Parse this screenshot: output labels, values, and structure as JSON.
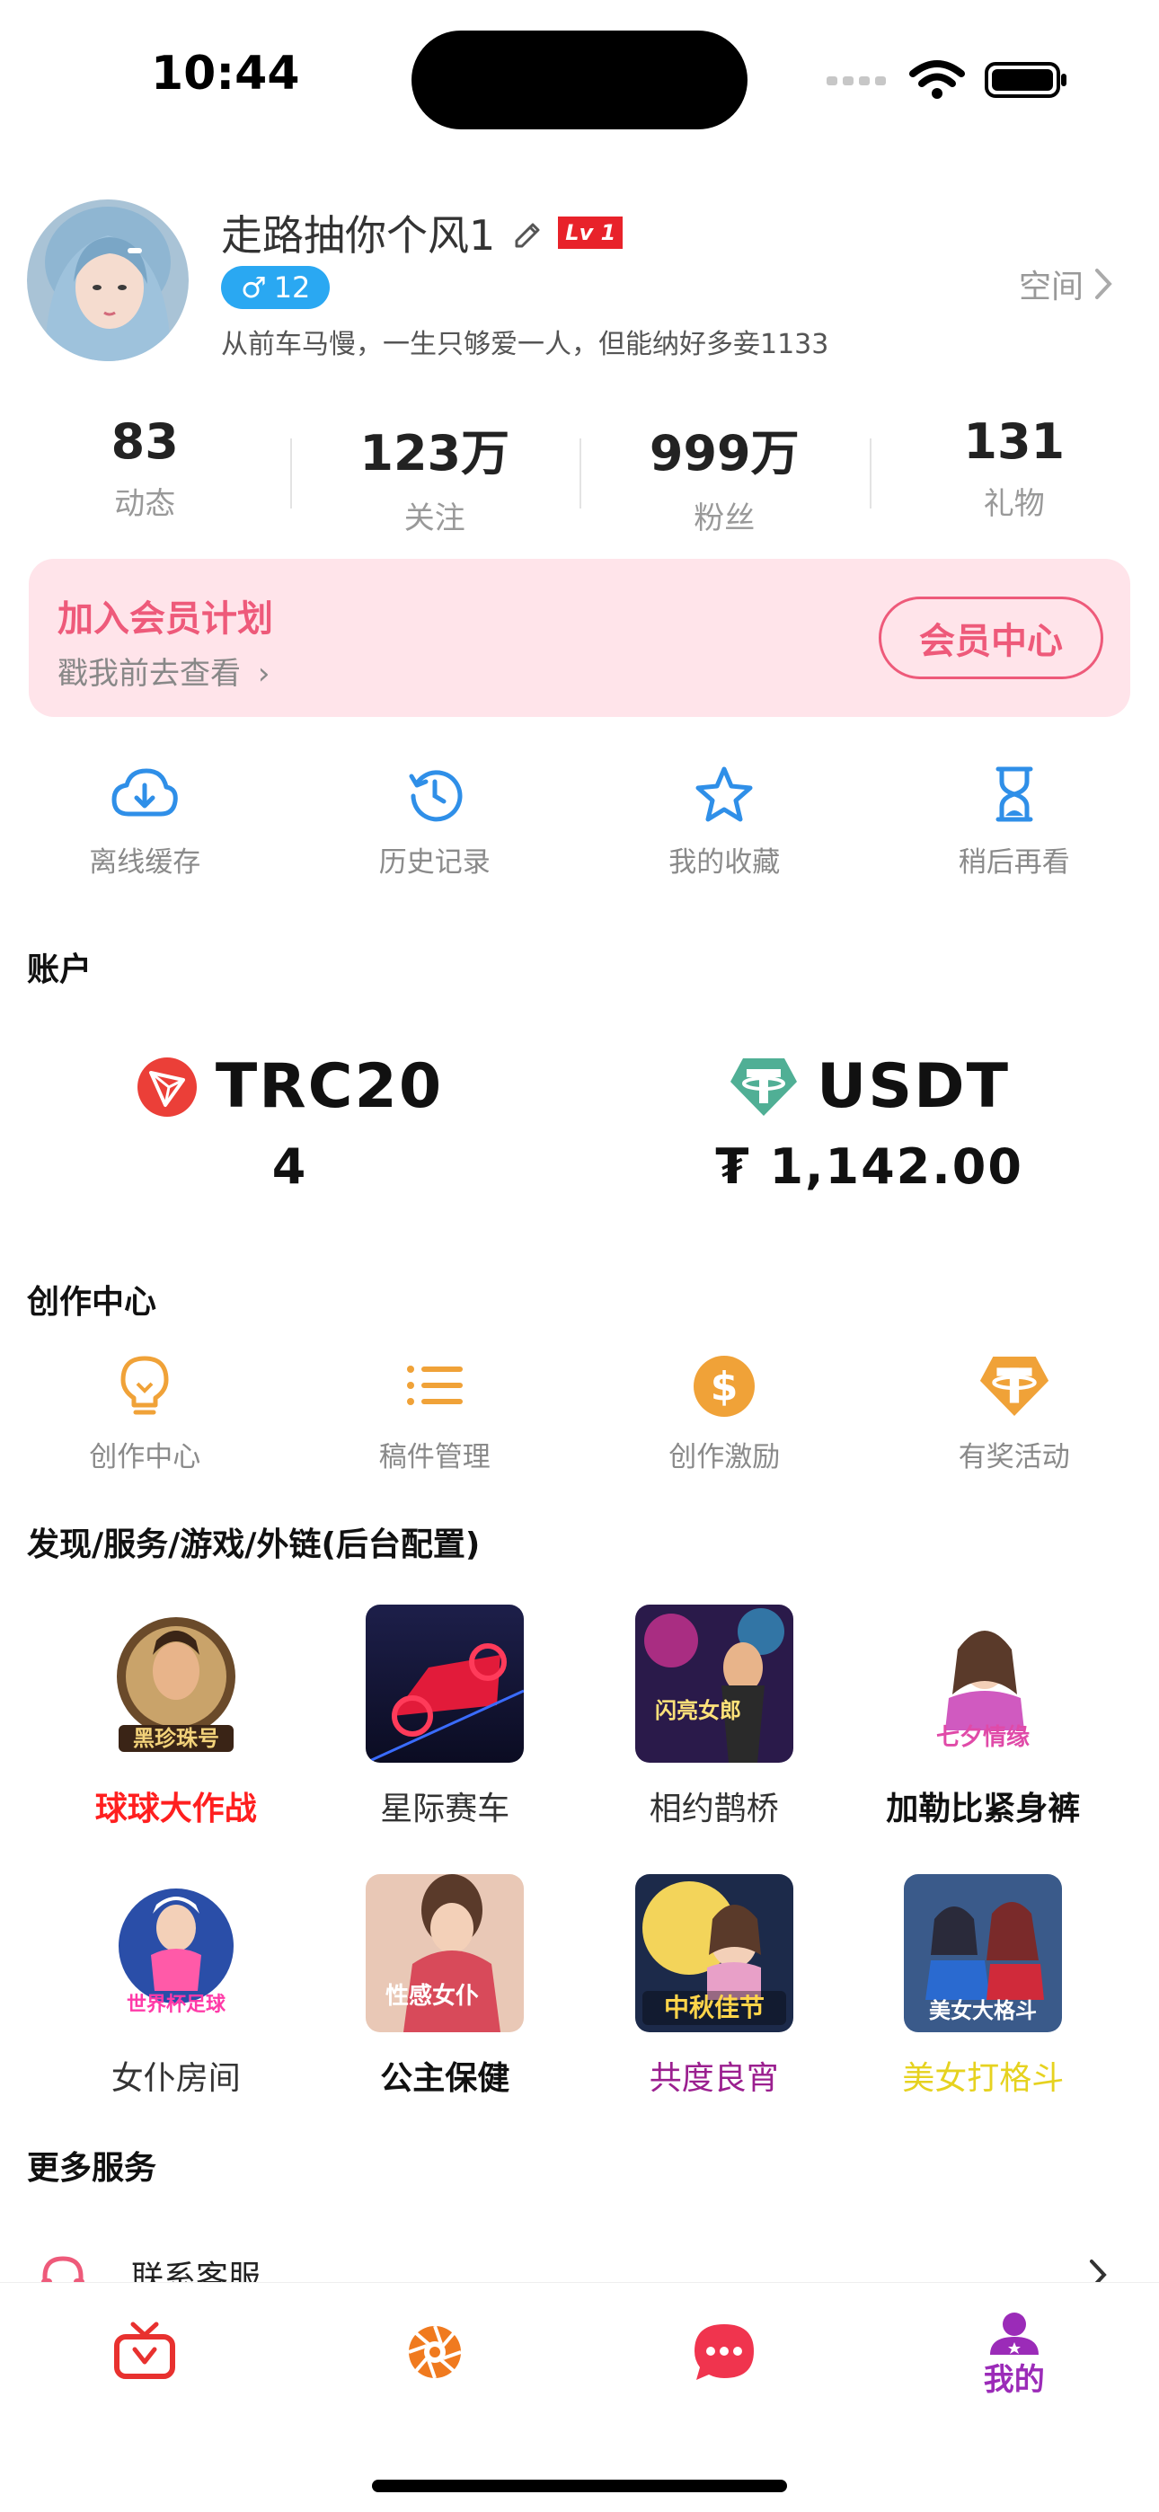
{
  "status_bar": {
    "time": "10:44"
  },
  "profile": {
    "name": "走路抽你个风1",
    "level_badge": "Lv 1",
    "gender_age": "12",
    "bio": "从前车马慢，一生只够爱一人，但能纳好多妾1133",
    "space_label": "空间"
  },
  "stats": [
    {
      "value": "83",
      "label": "动态"
    },
    {
      "value": "123万",
      "label": "关注"
    },
    {
      "value": "999万",
      "label": "粉丝"
    },
    {
      "value": "131",
      "label": "礼物"
    }
  ],
  "vip": {
    "title": "加入会员计划",
    "subtitle": "戳我前去查看",
    "button": "会员中心"
  },
  "quick_actions": [
    {
      "label": "离线缓存",
      "icon": "cloud-download-icon"
    },
    {
      "label": "历史记录",
      "icon": "history-icon"
    },
    {
      "label": "我的收藏",
      "icon": "star-icon"
    },
    {
      "label": "稍后再看",
      "icon": "hourglass-icon"
    }
  ],
  "account": {
    "title": "账户",
    "items": [
      {
        "name": "TRC20",
        "value": "4",
        "icon": "tron-icon"
      },
      {
        "name": "USDT",
        "value": "₮ 1,142.00",
        "icon": "tether-icon"
      }
    ]
  },
  "creator": {
    "title": "创作中心",
    "items": [
      {
        "label": "创作中心",
        "icon": "lightbulb-icon"
      },
      {
        "label": "稿件管理",
        "icon": "list-icon"
      },
      {
        "label": "创作激励",
        "icon": "dollar-icon"
      },
      {
        "label": "有奖活动",
        "icon": "tether-icon"
      }
    ]
  },
  "discover": {
    "title": "发现/服务/游戏/外链(后台配置)",
    "games": [
      {
        "label": "球球大作战",
        "color": "#ff1f1f",
        "bold": true,
        "thumb_text": "黑珍珠号"
      },
      {
        "label": "星际赛车",
        "color": "#333333",
        "bold": false,
        "thumb_text": ""
      },
      {
        "label": "相约鹊桥",
        "color": "#333333",
        "bold": false,
        "thumb_text": "闪亮女郎"
      },
      {
        "label": "加勒比紧身裤",
        "color": "#111111",
        "bold": true,
        "thumb_text": "七夕情缘"
      },
      {
        "label": "女仆房间",
        "color": "#333333",
        "bold": false,
        "thumb_text": "世界杯足球"
      },
      {
        "label": "公主保健",
        "color": "#111111",
        "bold": true,
        "thumb_text": "性感女仆"
      },
      {
        "label": "共度良宵",
        "color": "#9b1f8f",
        "bold": false,
        "thumb_text": "中秋佳节"
      },
      {
        "label": "美女打格斗",
        "color": "#e6d21f",
        "bold": false,
        "thumb_text": "美女大格斗"
      }
    ]
  },
  "more_services": {
    "title": "更多服务",
    "first_item": "联系客服"
  },
  "tab_bar": {
    "tabs": [
      {
        "icon": "tv-icon",
        "label": ""
      },
      {
        "icon": "aperture-icon",
        "label": ""
      },
      {
        "icon": "chat-icon",
        "label": ""
      },
      {
        "icon": "profile-icon",
        "label": "我的"
      }
    ]
  },
  "colors": {
    "accent_pink": "#ee5a7a",
    "blue_icon": "#2f8fe8",
    "orange_icon": "#f0a238",
    "tab_purple": "#9b2bb8"
  }
}
